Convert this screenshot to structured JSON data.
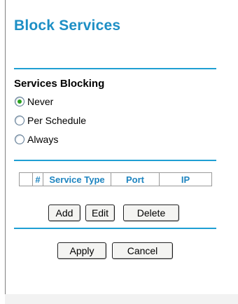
{
  "page": {
    "title": "Block Services"
  },
  "blocking": {
    "label": "Services Blocking",
    "options": [
      {
        "label": "Never",
        "checked": true
      },
      {
        "label": "Per Schedule",
        "checked": false
      },
      {
        "label": "Always",
        "checked": false
      }
    ]
  },
  "table": {
    "headers": [
      "",
      "#",
      "Service Type",
      "Port",
      "IP"
    ]
  },
  "buttons": {
    "add": "Add",
    "edit": "Edit",
    "delete": "Delete",
    "apply": "Apply",
    "cancel": "Cancel"
  },
  "colors": {
    "accent": "#1d8fc5",
    "rule": "#1f9fd3",
    "radio_selected": "#2aa11e"
  }
}
